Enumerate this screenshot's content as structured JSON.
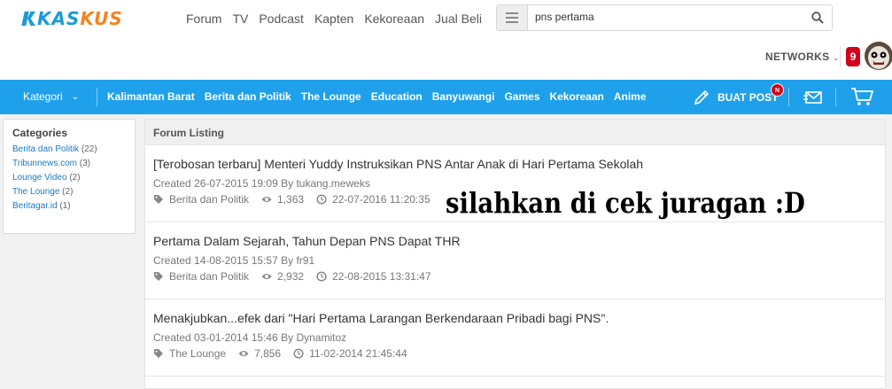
{
  "header": {
    "logo": {
      "part1": "KAS",
      "part2": "KUS"
    },
    "nav": [
      "Forum",
      "TV",
      "Podcast",
      "Kapten",
      "Kekoreaan",
      "Jual Beli"
    ],
    "search": {
      "query": "pns pertama"
    },
    "networks_label": "NETWORKS",
    "notification_count": "9"
  },
  "bluenav": {
    "kategori_label": "Kategori",
    "links": [
      "Kalimantan Barat",
      "Berita dan Politik",
      "The Lounge",
      "Education",
      "Banyuwangi",
      "Games",
      "Kekoreaan",
      "Anime"
    ],
    "buat_post_label": "BUAT POST",
    "new_badge": "N"
  },
  "sidebar": {
    "heading": "Categories",
    "items": [
      {
        "label": "Berita dan Politik",
        "count": "(22)"
      },
      {
        "label": "Tribunnews.com",
        "count": "(3)"
      },
      {
        "label": "Lounge Video",
        "count": "(2)"
      },
      {
        "label": "The Lounge",
        "count": "(2)"
      },
      {
        "label": "Beritagar.id",
        "count": "(1)"
      }
    ]
  },
  "listing": {
    "heading": "Forum Listing",
    "threads": [
      {
        "title": "[Terobosan terbaru] Menteri Yuddy Instruksikan PNS Antar Anak di Hari Pertama Sekolah",
        "created": "Created 26-07-2015 19:09 By tukang.meweks",
        "category": "Berita dan Politik",
        "views": "1,363",
        "last": "22-07-2016 11:20:35"
      },
      {
        "title": "Pertama Dalam Sejarah, Tahun Depan PNS Dapat THR",
        "created": "Created 14-08-2015 15:57 By fr91",
        "category": "Berita dan Politik",
        "views": "2,932",
        "last": "22-08-2015 13:31:47"
      },
      {
        "title": "Menakjubkan...efek dari \"Hari Pertama Larangan Berkendaraan Pribadi bagi PNS\".",
        "created": "Created 03-01-2014 15:46 By Dynamitoz",
        "category": "The Lounge",
        "views": "7,856",
        "last": "11-02-2014 21:45:44"
      }
    ]
  },
  "overlay_caption": "silahkan di cek juragan :D",
  "colors": {
    "brand_blue": "#1fa0eb",
    "brand_orange": "#f58220",
    "badge_red": "#d0021b"
  }
}
